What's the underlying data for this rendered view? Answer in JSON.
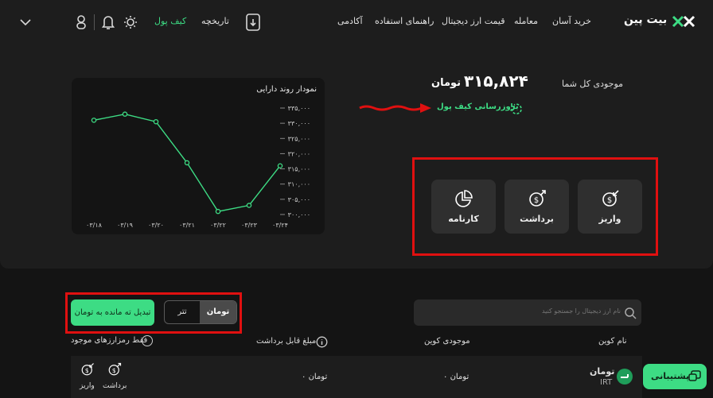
{
  "brand": {
    "logo_text": "بیت پین"
  },
  "nav": {
    "links": [
      "خرید آسان",
      "معامله",
      "قیمت ارز دیجیتال",
      "راهنمای استفاده",
      "آکادمی"
    ],
    "history": "تاریخچه",
    "wallet": "کیف پول"
  },
  "balance": {
    "label": "موجودی کل شما",
    "amount": "۳۱۵,۸۲۴",
    "unit": "تومان",
    "refresh": "بروزرسانی کیف پول"
  },
  "actions": {
    "deposit": "واریز",
    "withdraw": "برداشت",
    "report": "کارنامه"
  },
  "chart": {
    "title": "نمودار روند دارایی"
  },
  "chart_data": {
    "type": "line",
    "title": "نمودار روند دارایی",
    "x": [
      "۰۳/۱۸",
      "۰۳/۱۹",
      "۰۳/۲۰",
      "۰۳/۲۱",
      "۰۳/۲۲",
      "۰۳/۲۳",
      "۰۳/۲۴"
    ],
    "y_ticks": [
      "۳۳۵,۰۰۰",
      "۳۳۰,۰۰۰",
      "۳۲۵,۰۰۰",
      "۳۲۰,۰۰۰",
      "۳۱۵,۰۰۰",
      "۳۱۰,۰۰۰",
      "۳۰۵,۰۰۰",
      "۳۰۰,۰۰۰"
    ],
    "ylim": [
      300000,
      335000
    ],
    "series": [
      {
        "values": [
          331000,
          333000,
          330500,
          317000,
          301000,
          303000,
          316000
        ]
      }
    ],
    "color": "#3ddc84",
    "grid": false
  },
  "filters": {
    "search_placeholder": "نام ارز دیجیتال را جستجو کنید",
    "tab_toman": "تومان",
    "tab_tether": "تتر",
    "convert": "تبدیل ته مانده به تومان",
    "only_available": "فقط رمزارزهای موجود"
  },
  "table": {
    "headers": [
      "نام کوین",
      "موجودی کوین",
      "مبلغ قابل برداشت"
    ],
    "rows": [
      {
        "name": "تومان",
        "symbol": "IRT",
        "balance": "۰ تومان",
        "withdrawable": "۰ تومان",
        "deposit": "واریز",
        "withdraw": "برداشت"
      }
    ]
  },
  "support": {
    "label": "پشتیبانی"
  },
  "colors": {
    "accent": "#3ddc84",
    "highlight": "#e01010",
    "background": "#141414",
    "panel": "#1d1d1d"
  }
}
